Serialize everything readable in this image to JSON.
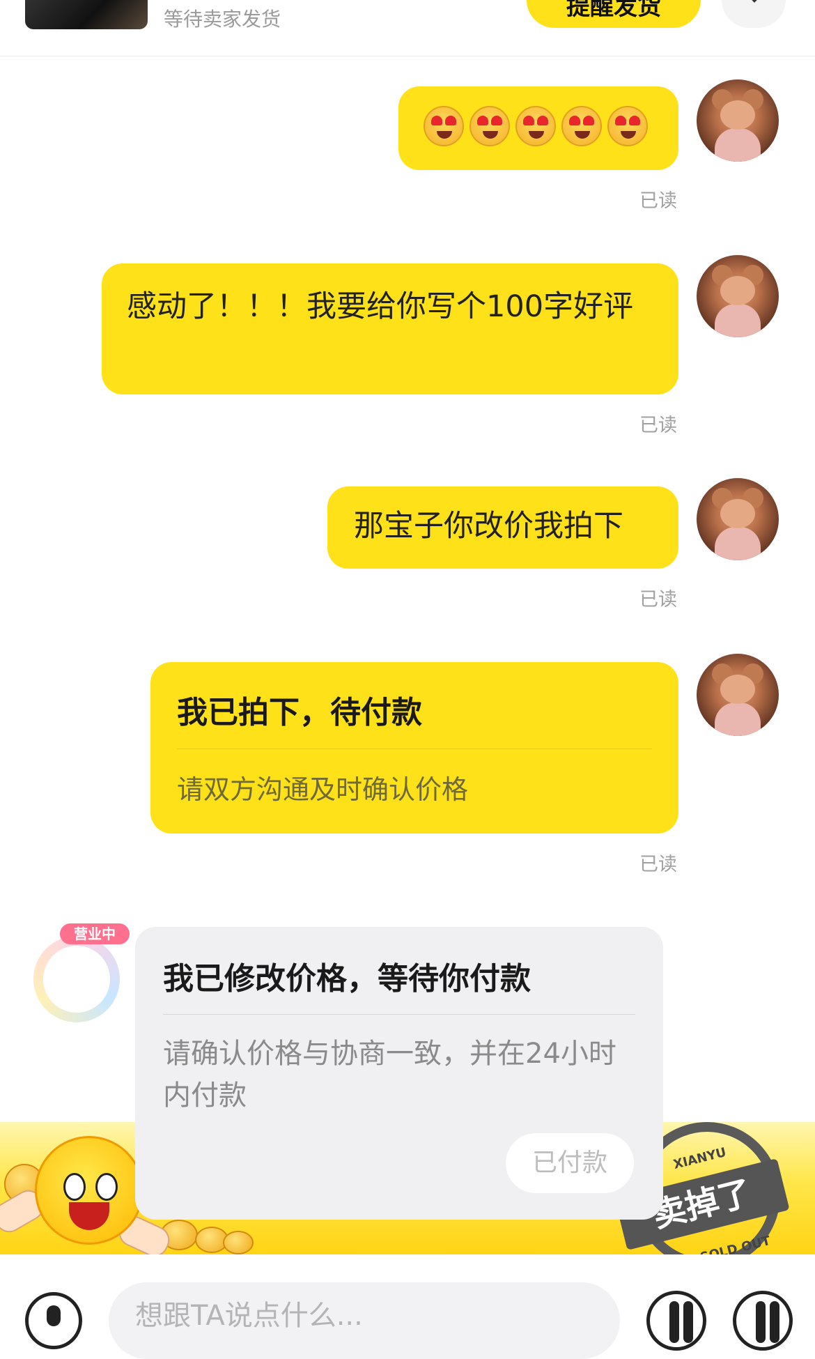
{
  "order": {
    "status": "等待卖家发货",
    "remind_button": "提醒发货"
  },
  "messages": [
    {
      "sender": "me",
      "kind": "emoji",
      "emoji": "heart-eyes-emoji",
      "count": 5,
      "read": "已读"
    },
    {
      "sender": "me",
      "kind": "text",
      "text": "感动了！！！我要给你写个100字好评",
      "read": "已读"
    },
    {
      "sender": "me",
      "kind": "text",
      "text": "那宝子你改价我拍下",
      "read": "已读"
    },
    {
      "sender": "me",
      "kind": "card",
      "title": "我已拍下，待付款",
      "subtitle": "请双方沟通及时确认价格",
      "read": "已读"
    },
    {
      "sender": "seller",
      "kind": "card",
      "badge": "营业中",
      "title": "我已修改价格，等待你付款",
      "subtitle": "请确认价格与协商一致，并在24小时内付款",
      "button": "已付款"
    }
  ],
  "banner": {
    "stamp_brand": "XIANYU",
    "stamp_text": "卖掉了",
    "stamp_sub": "SOLD OUT"
  },
  "input": {
    "placeholder": "想跟TA说点什么..."
  },
  "colors": {
    "accent": "#ffe11a",
    "read_text": "#a0a0a0",
    "seller_bubble": "#f0f0f2"
  }
}
